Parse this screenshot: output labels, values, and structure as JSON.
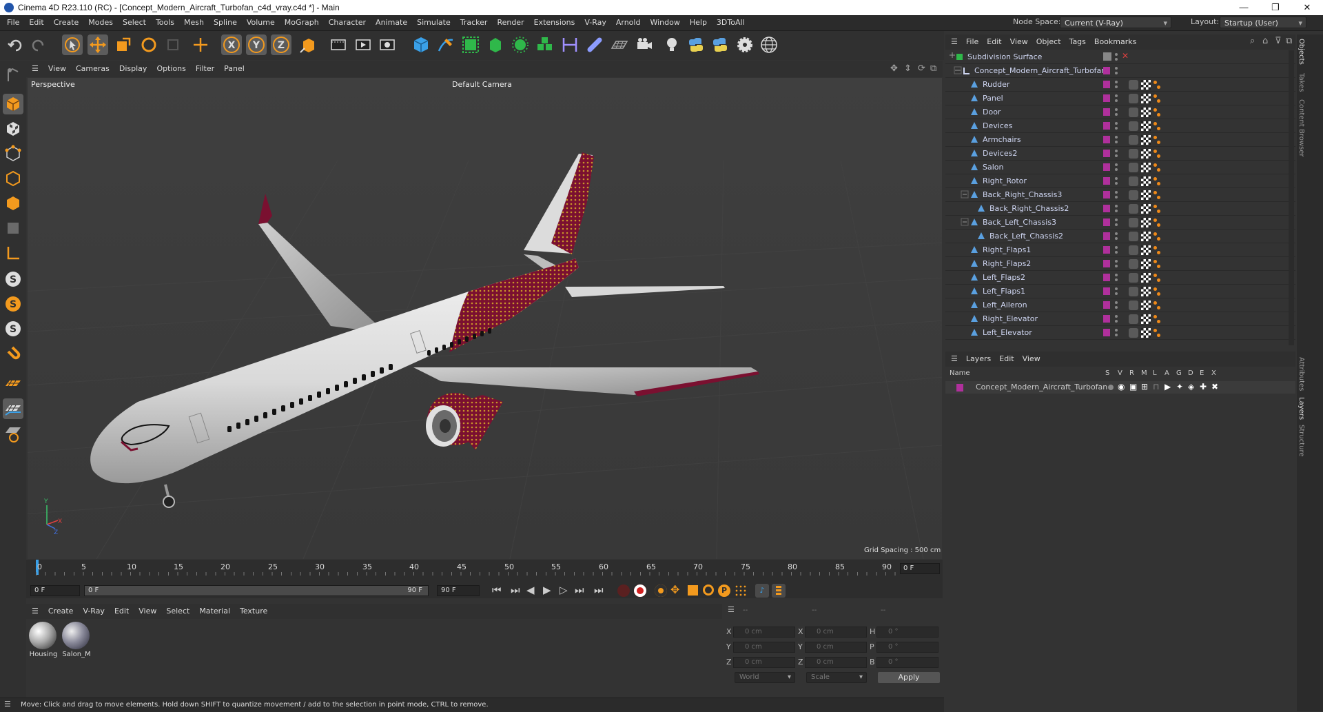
{
  "window": {
    "title": "Cinema 4D R23.110 (RC) - [Concept_Modern_Aircraft_Turbofan_c4d_vray.c4d *] - Main",
    "controls": [
      "—",
      "❐",
      "✕"
    ]
  },
  "menubar": {
    "items": [
      "File",
      "Edit",
      "Create",
      "Modes",
      "Select",
      "Tools",
      "Mesh",
      "Spline",
      "Volume",
      "MoGraph",
      "Character",
      "Animate",
      "Simulate",
      "Tracker",
      "Render",
      "Extensions",
      "V-Ray",
      "Arnold",
      "Window",
      "Help",
      "3DToAll"
    ],
    "node_space_label": "Node Space:",
    "node_space_value": "Current (V-Ray)",
    "layout_label": "Layout:",
    "layout_value": "Startup (User)"
  },
  "viewport": {
    "menu": [
      "View",
      "Cameras",
      "Display",
      "Options",
      "Filter",
      "Panel"
    ],
    "view_name": "Perspective",
    "camera": "Default Camera",
    "grid_spacing": "Grid Spacing : 500 cm",
    "axis_labels": {
      "y": "Y",
      "x": "X",
      "z": "Z"
    },
    "colors": {
      "fuselage": "#e4e4e4",
      "livery": "#7a1030",
      "engine_pattern": "#c8952a",
      "floor": "#3a3a3a"
    }
  },
  "timeline": {
    "ticks": [
      "0",
      "5",
      "10",
      "15",
      "20",
      "25",
      "30",
      "35",
      "40",
      "45",
      "50",
      "55",
      "60",
      "65",
      "70",
      "75",
      "80",
      "85",
      "90"
    ],
    "current_frame_right": "0 F",
    "start_field": "0 F",
    "range_start": "0 F",
    "range_end": "90 F",
    "end_field": "90 F"
  },
  "material_manager": {
    "menu": [
      "Create",
      "V-Ray",
      "Edit",
      "View",
      "Select",
      "Material",
      "Texture"
    ],
    "materials": [
      {
        "name": "Housing"
      },
      {
        "name": "Salon_M"
      }
    ]
  },
  "coordinates": {
    "header": [
      "--",
      "--",
      "--"
    ],
    "rows": [
      {
        "l1": "X",
        "v1": "0 cm",
        "l2": "X",
        "v2": "0 cm",
        "l3": "H",
        "v3": "0 °"
      },
      {
        "l1": "Y",
        "v1": "0 cm",
        "l2": "Y",
        "v2": "0 cm",
        "l3": "P",
        "v3": "0 °"
      },
      {
        "l1": "Z",
        "v1": "0 cm",
        "l2": "Z",
        "v2": "0 cm",
        "l3": "B",
        "v3": "0 °"
      }
    ],
    "mode_world": "World",
    "mode_scale": "Scale",
    "apply": "Apply"
  },
  "status": {
    "text": "Move: Click and drag to move elements. Hold down SHIFT to quantize movement / add to the selection in point mode, CTRL to remove."
  },
  "object_manager": {
    "menu": [
      "File",
      "Edit",
      "View",
      "Object",
      "Tags",
      "Bookmarks"
    ],
    "objects": [
      {
        "name": "Subdivision Surface",
        "indent": 0
      },
      {
        "name": "Concept_Modern_Aircraft_Turbofan",
        "indent": 1
      },
      {
        "name": "Rudder",
        "indent": 2
      },
      {
        "name": "Panel",
        "indent": 2
      },
      {
        "name": "Door",
        "indent": 2
      },
      {
        "name": "Devices",
        "indent": 2
      },
      {
        "name": "Armchairs",
        "indent": 2
      },
      {
        "name": "Devices2",
        "indent": 2
      },
      {
        "name": "Salon",
        "indent": 2
      },
      {
        "name": "Right_Rotor",
        "indent": 2
      },
      {
        "name": "Back_Right_Chassis3",
        "indent": 2
      },
      {
        "name": "Back_Right_Chassis2",
        "indent": 3
      },
      {
        "name": "Back_Left_Chassis3",
        "indent": 2
      },
      {
        "name": "Back_Left_Chassis2",
        "indent": 3
      },
      {
        "name": "Right_Flaps1",
        "indent": 2
      },
      {
        "name": "Right_Flaps2",
        "indent": 2
      },
      {
        "name": "Left_Flaps2",
        "indent": 2
      },
      {
        "name": "Left_Flaps1",
        "indent": 2
      },
      {
        "name": "Left_Aileron",
        "indent": 2
      },
      {
        "name": "Right_Elevator",
        "indent": 2
      },
      {
        "name": "Left_Elevator",
        "indent": 2
      }
    ]
  },
  "layers": {
    "menu": [
      "Layers",
      "Edit",
      "View"
    ],
    "columns": [
      "Name",
      "S",
      "V",
      "R",
      "M",
      "L",
      "A",
      "G",
      "D",
      "E",
      "X"
    ],
    "rows": [
      {
        "name": "Concept_Modern_Aircraft_Turbofan"
      }
    ]
  },
  "right_tabs": [
    "Objects",
    "Takes",
    "Content Browser",
    "Attributes",
    "Layers",
    "Structure"
  ]
}
